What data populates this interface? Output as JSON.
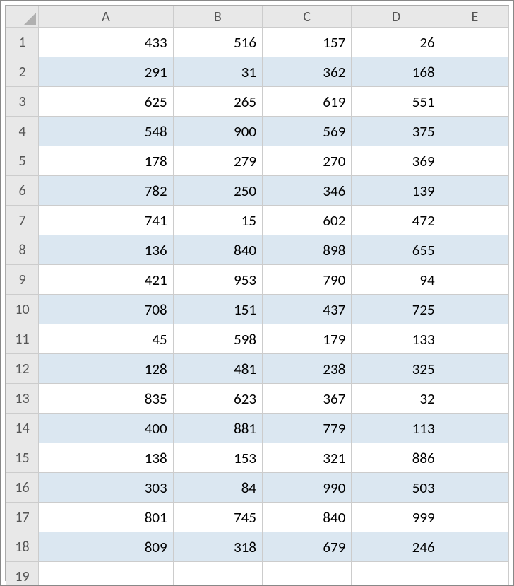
{
  "columns": [
    "A",
    "B",
    "C",
    "D",
    "E"
  ],
  "rowCount": 19,
  "chart_data": {
    "type": "table",
    "title": "",
    "columns": [
      "A",
      "B",
      "C",
      "D"
    ],
    "rows": [
      [
        433,
        516,
        157,
        26
      ],
      [
        291,
        31,
        362,
        168
      ],
      [
        625,
        265,
        619,
        551
      ],
      [
        548,
        900,
        569,
        375
      ],
      [
        178,
        279,
        270,
        369
      ],
      [
        782,
        250,
        346,
        139
      ],
      [
        741,
        15,
        602,
        472
      ],
      [
        136,
        840,
        898,
        655
      ],
      [
        421,
        953,
        790,
        94
      ],
      [
        708,
        151,
        437,
        725
      ],
      [
        45,
        598,
        179,
        133
      ],
      [
        128,
        481,
        238,
        325
      ],
      [
        835,
        623,
        367,
        32
      ],
      [
        400,
        881,
        779,
        113
      ],
      [
        138,
        153,
        321,
        886
      ],
      [
        303,
        84,
        990,
        503
      ],
      [
        801,
        745,
        840,
        999
      ],
      [
        809,
        318,
        679,
        246
      ]
    ]
  }
}
